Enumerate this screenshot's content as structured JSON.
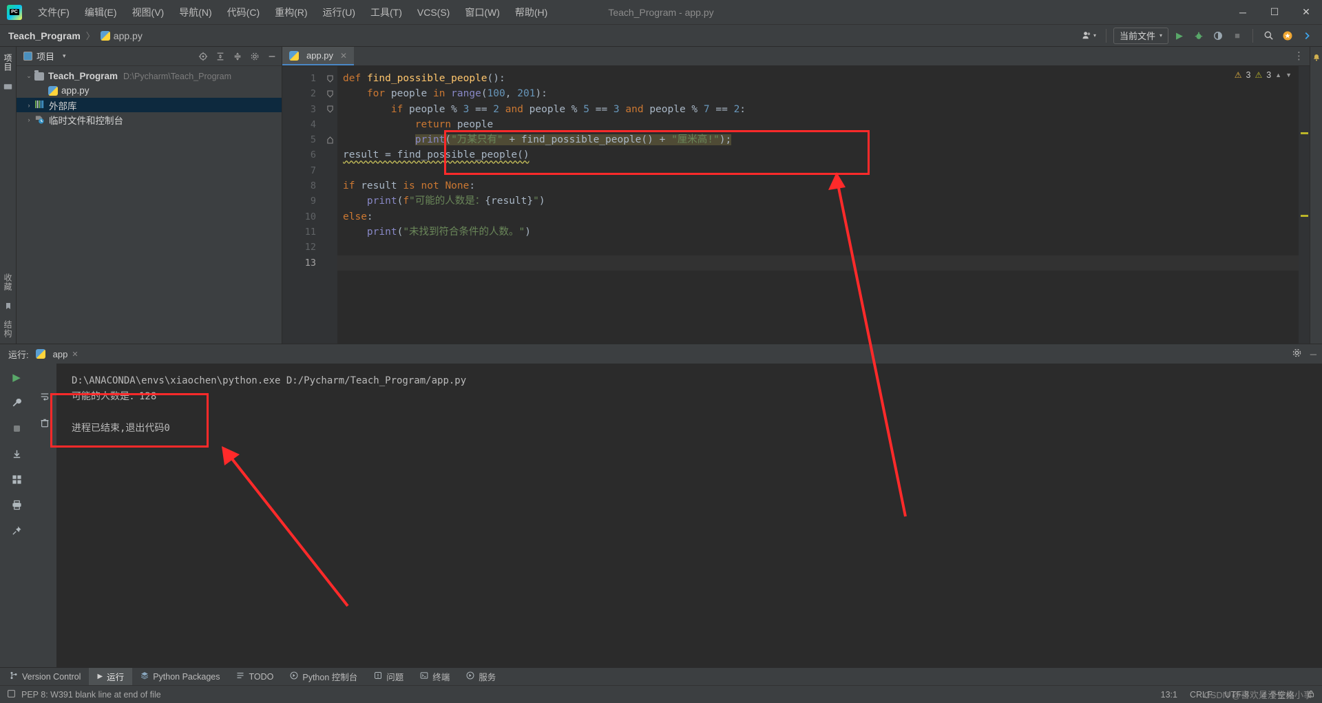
{
  "titlebar": {
    "logo": "PC",
    "menus": [
      {
        "label": "文件(F)",
        "name": "menu-file"
      },
      {
        "label": "编辑(E)",
        "name": "menu-edit"
      },
      {
        "label": "视图(V)",
        "name": "menu-view"
      },
      {
        "label": "导航(N)",
        "name": "menu-navigate"
      },
      {
        "label": "代码(C)",
        "name": "menu-code"
      },
      {
        "label": "重构(R)",
        "name": "menu-refactor"
      },
      {
        "label": "运行(U)",
        "name": "menu-run"
      },
      {
        "label": "工具(T)",
        "name": "menu-tools"
      },
      {
        "label": "VCS(S)",
        "name": "menu-vcs"
      },
      {
        "label": "窗口(W)",
        "name": "menu-window"
      },
      {
        "label": "帮助(H)",
        "name": "menu-help"
      }
    ],
    "window_title": "Teach_Program - app.py",
    "minimize": "─",
    "maximize": "☐",
    "close": "✕"
  },
  "navbar": {
    "crumb_project": "Teach_Program",
    "crumb_sep": "〉",
    "crumb_file": "app.py",
    "run_config": "当前文件",
    "run_config_caret": "▾",
    "account_icon": "user-icon",
    "run_icon": "▶",
    "debug_icon": "✷",
    "coverage_icon": "◑",
    "stop_icon": "■",
    "search_icon": "⌕",
    "settings_icon": "⚙",
    "more_icon": "⋮"
  },
  "toolstrip": {
    "labels": [
      "项目",
      "结构"
    ],
    "bottom_labels": [
      "收藏",
      "结构"
    ]
  },
  "project": {
    "header_title": "项目",
    "header_caret": "▾",
    "icons": [
      "target-icon",
      "collapse-icon",
      "expand-icon",
      "gear-icon",
      "minimize-icon"
    ],
    "tree": [
      {
        "name": "tree-item-project",
        "twist": "⌄",
        "label": "Teach_Program",
        "path": "D:\\Pycharm\\Teach_Program",
        "bold": true,
        "selected": false,
        "icon": "folder"
      },
      {
        "name": "tree-item-apppy",
        "twist": "",
        "label": "app.py",
        "path": "",
        "bold": false,
        "selected": false,
        "icon": "python"
      },
      {
        "name": "tree-item-external-libraries",
        "twist": "›",
        "label": "外部库",
        "path": "",
        "bold": false,
        "selected": true,
        "icon": "lib"
      },
      {
        "name": "tree-item-scratches",
        "twist": "›",
        "label": "临时文件和控制台",
        "path": "",
        "bold": false,
        "selected": false,
        "icon": "clock"
      }
    ]
  },
  "editor": {
    "tab_label": "app.py",
    "tab_close": "✕",
    "warn_count": "3",
    "weakwarn_count": "3",
    "warn_icon": "⚠",
    "line_numbers": [
      "1",
      "2",
      "3",
      "4",
      "5",
      "6",
      "7",
      "8",
      "9",
      "10",
      "11",
      "12",
      "13"
    ],
    "current_line": 13,
    "code": [
      "def find_possible_people():",
      "    for people in range(100, 201):",
      "        if people % 3 == 2 and people % 5 == 3 and people % 7 == 2:",
      "            return people",
      "            print(\"万某只有\" + find_possible_people() + \"厘米高!\");",
      "result = find_possible_people()",
      "",
      "if result is not None:",
      "    print(f\"可能的人数是：{result}\")",
      "else:",
      "    print(\"未找到符合条件的人数。\")",
      "",
      ""
    ]
  },
  "run_panel": {
    "label": "运行:",
    "tab_name": "app",
    "tab_close": "✕",
    "gear_icon": "⚙",
    "minimize_icon": "─",
    "side_icons": [
      "run-icon",
      "wrench-icon",
      "stop-icon",
      "download-icon",
      "grid-icon",
      "print-icon",
      "pin-icon",
      "trash-icon"
    ],
    "output": [
      "D:\\ANACONDA\\envs\\xiaochen\\python.exe D:/Pycharm/Teach_Program/app.py",
      "可能的人数是：128",
      "进程已结束,退出代码0"
    ]
  },
  "bottom_tabs": [
    {
      "label": "Version Control",
      "icon": "⎇",
      "name": "tab-version-control",
      "selected": false
    },
    {
      "label": "运行",
      "icon": "▶",
      "name": "tab-run",
      "selected": true
    },
    {
      "label": "Python Packages",
      "icon": "☰",
      "name": "tab-python-packages",
      "selected": false
    },
    {
      "label": "TODO",
      "icon": "☰",
      "name": "tab-todo",
      "selected": false
    },
    {
      "label": "Python 控制台",
      "icon": "▶",
      "name": "tab-python-console",
      "selected": false
    },
    {
      "label": "问题",
      "icon": "⚠",
      "name": "tab-problems",
      "selected": false
    },
    {
      "label": "终端",
      "icon": "⌨",
      "name": "tab-terminal",
      "selected": false
    },
    {
      "label": "服务",
      "icon": "⚙",
      "name": "tab-services",
      "selected": false
    }
  ],
  "statusbar": {
    "message": "PEP 8: W391 blank line at end of file",
    "message_icon": "☐",
    "caret": "13:1",
    "line_sep": "CRLF",
    "encoding": "UTF-8",
    "indent": "4 个空格",
    "lock_icon": "⚿",
    "watermark": "CSDN @喜欢是漫长火小事"
  },
  "colors": {
    "accent_blue": "#4a88c7",
    "annotation_red": "#ff2a2a",
    "bg_panel": "#3c3f41",
    "bg_editor": "#2b2b2b",
    "selection": "#0d293e",
    "keyword": "#cc7832",
    "string": "#6a8759",
    "number": "#6897bb",
    "function": "#ffc66d",
    "builtin": "#8888c6",
    "highlight": "#4f4b35"
  }
}
